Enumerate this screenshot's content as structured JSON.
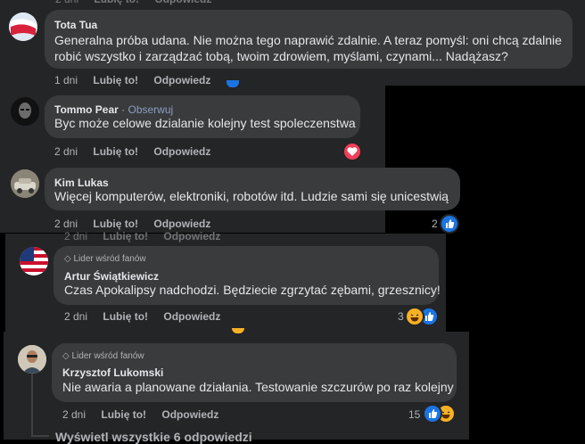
{
  "comments": [
    {
      "name": "Tota Tua",
      "text_lines": [
        "Generalna próba udana. Nie można tego naprawić zdalnie. A teraz pomyśl: oni chcą zdalnie",
        "robić wszystko i zarządzać tobą, twoim zdrowiem, myślami, czynami... Nadążasz?"
      ],
      "time": "1 dni",
      "like_label": "Lubię to!",
      "reply_label": "Odpowiedz"
    },
    {
      "name": "Tommo Pear",
      "follow_sep": "·",
      "follow_label": "Obserwuj",
      "text": "Byc może celowe dzialanie kolejny test spoleczenstwa",
      "time": "2 dni",
      "like_label": "Lubię to!",
      "reply_label": "Odpowiedz",
      "reactions": [
        "love"
      ]
    },
    {
      "name": "Kim Lukas",
      "text": "Więcej komputerów, elektroniki, robotów itd. Ludzie sami się unicestwią",
      "time": "2 dni",
      "like_label": "Lubię to!",
      "reply_label": "Odpowiedz",
      "reaction_count": "2",
      "reactions": [
        "like"
      ]
    },
    {
      "badge": "Lider wśród fanów",
      "name": "Artur Świątkiewicz",
      "text": "Czas Apokalipsy nadchodzi. Będziecie zgrzytać zębami, grzesznicy!",
      "time": "2 dni",
      "like_label": "Lubię to!",
      "reply_label": "Odpowiedz",
      "reaction_count": "3",
      "reactions": [
        "haha",
        "like"
      ]
    },
    {
      "badge": "Lider wśród fanów",
      "name": "Krzysztof Lukomski",
      "text": "Nie awaria a planowane działania. Testowanie szczurów po raz kolejny",
      "time": "2 dni",
      "like_label": "Lubię to!",
      "reply_label": "Odpowiedz",
      "reaction_count": "15",
      "reactions": [
        "like",
        "haha"
      ]
    }
  ],
  "view_replies": "Wyświetl wszystkie 6 odpowiedzi",
  "ghost_actions": {
    "time": "2 dni",
    "like_label": "Lubię to!",
    "reply_label": "Odpowiedz"
  },
  "colors": {
    "panel": "#242526",
    "bubble": "#3a3b3c",
    "like": "#1b74e4",
    "love": "#f33e58",
    "haha": "#f7b125",
    "link": "#8b9dc3"
  }
}
